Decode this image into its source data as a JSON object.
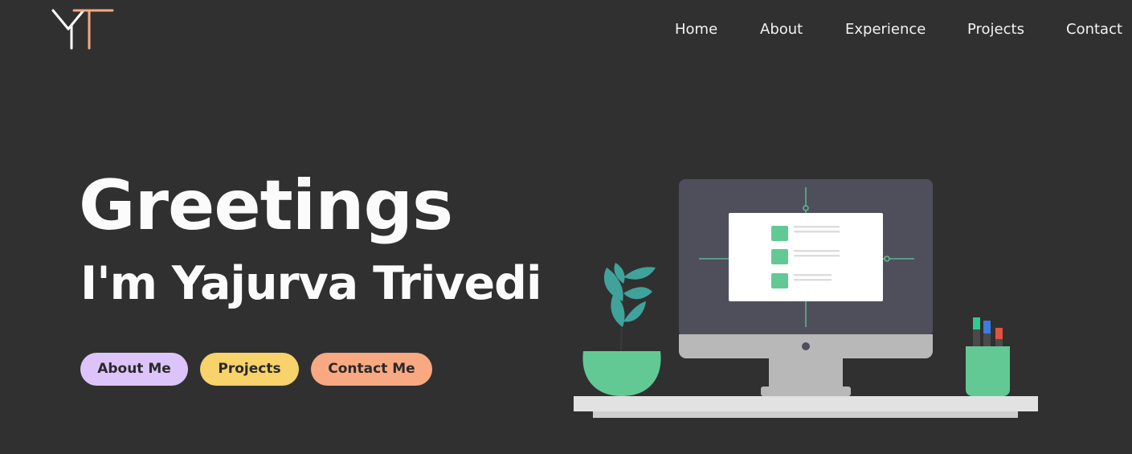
{
  "logo": {
    "text": "YT",
    "colors": {
      "y": "#ffffff",
      "t": "#f6a882"
    }
  },
  "nav": {
    "items": [
      {
        "label": "Home"
      },
      {
        "label": "About"
      },
      {
        "label": "Experience"
      },
      {
        "label": "Projects"
      },
      {
        "label": "Contact"
      }
    ]
  },
  "hero": {
    "title": "Greetings",
    "subtitle": "I'm Yajurva Trivedi",
    "buttons": [
      {
        "label": "About Me",
        "color": "#dcc4fb"
      },
      {
        "label": "Projects",
        "color": "#f8d26a"
      },
      {
        "label": "Contact Me",
        "color": "#f9a982"
      }
    ]
  },
  "illustration": {
    "subject": "desktop-computer-on-desk",
    "colors": {
      "background": "#303030",
      "monitor": "#4f4f5c",
      "screen_card": "#ffffff",
      "accent_green": "#62c995",
      "leaf_teal": "#3fa39c",
      "desk": "#e2e2e2",
      "stand": "#b8b8b8"
    }
  }
}
